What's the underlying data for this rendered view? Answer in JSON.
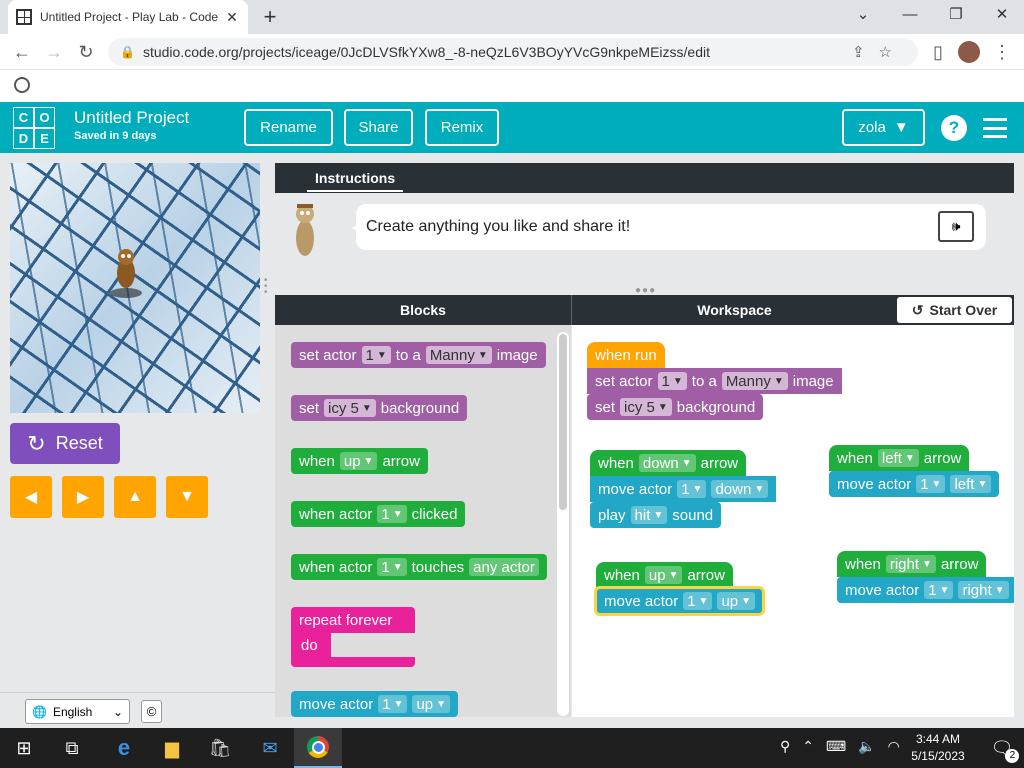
{
  "browser": {
    "tab_title": "Untitled Project - Play Lab - Code",
    "url": "studio.code.org/projects/iceage/0JcDLVSfkYXw8_-8-neQzL6V3BOyYVcG9nkpeMEizss/edit"
  },
  "header": {
    "logo_letters": [
      "C",
      "O",
      "D",
      "E"
    ],
    "project_name": "Untitled Project",
    "saved_text": "Saved in 9 days",
    "rename_label": "Rename",
    "share_label": "Share",
    "remix_label": "Remix",
    "user_label": "zola",
    "help_label": "?"
  },
  "stage": {
    "reset_label": "Reset",
    "language": "English",
    "copyright": "©"
  },
  "instructions": {
    "tab_label": "Instructions",
    "text": "Create anything you like and share it!"
  },
  "panels": {
    "blocks_label": "Blocks",
    "workspace_label": "Workspace",
    "start_over_label": "Start Over"
  },
  "toolbox": {
    "b1": {
      "pre": "set actor",
      "f1": "1",
      "mid": "to a",
      "f2": "Manny",
      "post": "image"
    },
    "b2": {
      "pre": "set",
      "f1": "icy 5",
      "post": "background"
    },
    "b3": {
      "pre": "when",
      "f1": "up",
      "post": "arrow"
    },
    "b4": {
      "pre": "when actor",
      "f1": "1",
      "post": "clicked"
    },
    "b5": {
      "pre": "when actor",
      "f1": "1",
      "mid": "touches",
      "f2": "any actor"
    },
    "b6": {
      "top": "repeat forever",
      "do": "do"
    },
    "b7": {
      "pre": "move actor",
      "f1": "1",
      "f2": "up"
    }
  },
  "workspace": {
    "run": {
      "hat": "when run",
      "s1_pre": "set actor",
      "s1_f1": "1",
      "s1_mid": "to a",
      "s1_f2": "Manny",
      "s1_post": "image",
      "s2_pre": "set",
      "s2_f1": "icy 5",
      "s2_post": "background"
    },
    "down": {
      "pre": "when",
      "f1": "down",
      "post": "arrow",
      "m_pre": "move actor",
      "m_f1": "1",
      "m_f2": "down",
      "p_pre": "play",
      "p_f1": "hit",
      "p_post": "sound"
    },
    "left": {
      "pre": "when",
      "f1": "left",
      "post": "arrow",
      "m_pre": "move actor",
      "m_f1": "1",
      "m_f2": "left"
    },
    "up": {
      "pre": "when",
      "f1": "up",
      "post": "arrow",
      "m_pre": "move actor",
      "m_f1": "1",
      "m_f2": "up"
    },
    "right": {
      "pre": "when",
      "f1": "right",
      "post": "arrow",
      "m_pre": "move actor",
      "m_f1": "1",
      "m_f2": "right"
    }
  },
  "taskbar": {
    "time": "3:44 AM",
    "date": "5/15/2023",
    "notif_count": "2"
  },
  "colors": {
    "header": "#00adbc",
    "purple": "#a05fa5",
    "green": "#1fae3c",
    "teal": "#22a8c6",
    "orange": "#ffa400",
    "pink": "#e9229b"
  }
}
